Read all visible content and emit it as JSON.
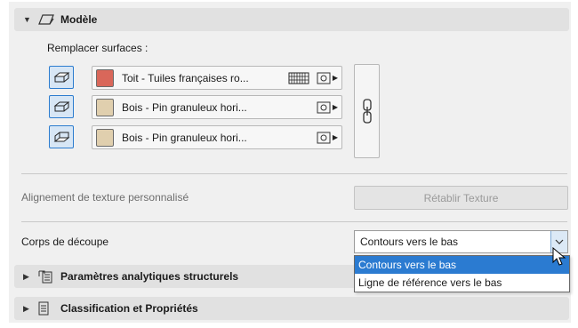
{
  "modele": {
    "title": "Modèle",
    "replace_label": "Remplacer surfaces :",
    "surfaces": [
      {
        "name": "Toit - Tuiles françaises ro...",
        "color": "#d9675a",
        "has_pattern": true
      },
      {
        "name": "Bois - Pin granuleux hori...",
        "color": "#e0cfae",
        "has_pattern": false
      },
      {
        "name": "Bois - Pin granuleux hori...",
        "color": "#e0cfae",
        "has_pattern": false
      }
    ],
    "texture_label": "Alignement de texture personnalisé",
    "reset_texture_button": "Rétablir Texture",
    "cut_body_label": "Corps de découpe",
    "cut_body_value": "Contours vers le bas",
    "cut_body_options": [
      "Contours vers le bas",
      "Ligne de référence vers le bas"
    ]
  },
  "sections": {
    "structural": "Paramètres analytiques structurels",
    "classification": "Classification et Propriétés"
  },
  "colors": {
    "accent": "#2b7bd1",
    "header_bg": "#e1e1e1"
  }
}
